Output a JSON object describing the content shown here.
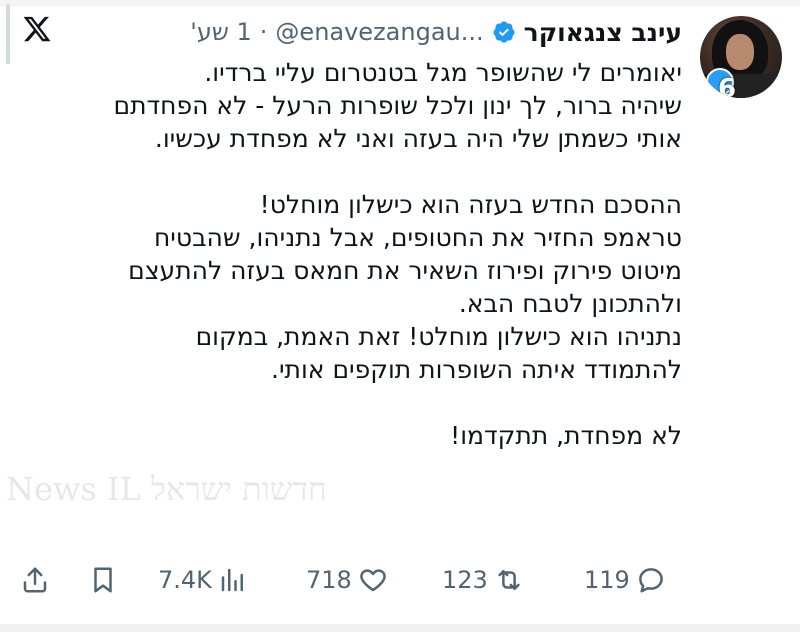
{
  "header": {
    "author_name": "עינב צנגאוקר",
    "handle": "@enavezangau...",
    "time": "1 שע'",
    "separator": "·"
  },
  "tweet": {
    "lines": [
      "יאומרים לי שהשופר מגל בטנטרום עליי ברדיו.",
      "שיהיה ברור, לך ינון ולכל שופרות הרעל - לא הפחדתם",
      "אותי כשמתן שלי היה בעזה ואני לא מפחדת עכשיו.",
      "",
      "ההסכם החדש בעזה הוא כישלון מוחלט!",
      "טראמפ החזיר את החטופים, אבל נתניהו, שהבטיח",
      "מיטוט פירוק ופירוז השאיר את חמאס בעזה להתעצם",
      "ולהתכונן לטבח הבא.",
      "נתניהו הוא כישלון מוחלט! זאת האמת, במקום",
      "להתמודד איתה השופרות תוקפים אותי.",
      "",
      "לא מפחדת, תתקדמו!"
    ]
  },
  "avatar_badge": "6",
  "watermark": "News IL  חדשות ישראל",
  "actions": {
    "replies": "119",
    "retweets": "123",
    "likes": "718",
    "views": "7.4K"
  },
  "icons": [
    "x-logo-icon",
    "verified-badge-icon",
    "reply-icon",
    "retweet-icon",
    "like-icon",
    "views-icon",
    "bookmark-icon",
    "share-icon"
  ],
  "colors": {
    "text": "#0f1419",
    "secondary": "#536471",
    "verified": "#1d9bf0"
  }
}
